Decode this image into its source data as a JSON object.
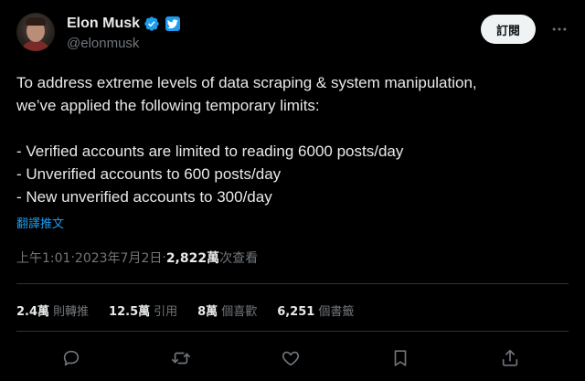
{
  "user": {
    "display_name": "Elon Musk",
    "handle": "@elonmusk"
  },
  "header": {
    "follow_label": "訂閱"
  },
  "tweet": {
    "lines": [
      "To address extreme levels of data scraping & system manipulation,",
      "we’ve applied the following temporary limits:",
      "- Verified accounts are limited to reading 6000 posts/day",
      "- Unverified accounts to 600 posts/day",
      "- New unverified accounts to 300/day"
    ],
    "translate_label": "翻譯推文"
  },
  "meta": {
    "time": "上午1:01",
    "sep1": " · ",
    "date": "2023年7月2日",
    "sep2": " · ",
    "views_count": "2,822萬",
    "views_label": " 次查看"
  },
  "stats": [
    {
      "num": "2.4萬",
      "label": "則轉推"
    },
    {
      "num": "12.5萬",
      "label": "引用"
    },
    {
      "num": "8萬",
      "label": "個喜歡"
    },
    {
      "num": "6,251",
      "label": "個書籤"
    }
  ],
  "colors": {
    "background": "#000000",
    "text": "#e7e9ea",
    "muted": "#71767b",
    "accent": "#1d9bf0",
    "divider": "#2f3336"
  }
}
